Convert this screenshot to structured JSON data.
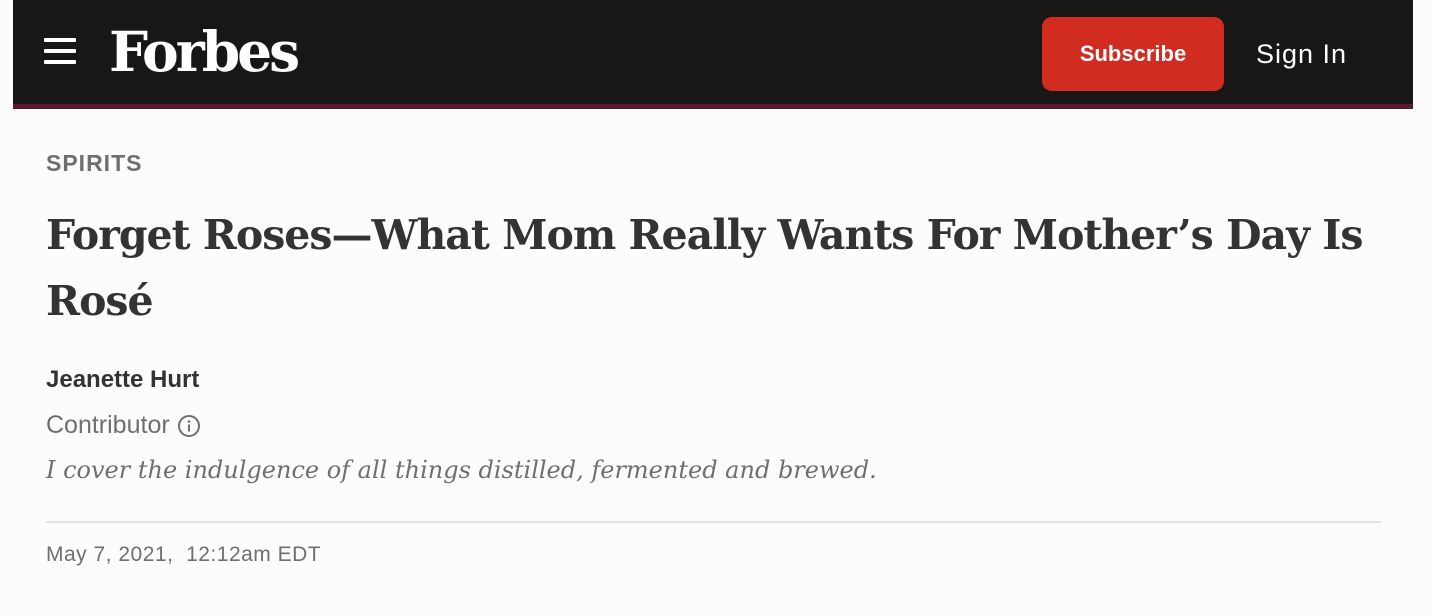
{
  "header": {
    "logo_text": "Forbes",
    "subscribe_label": "Subscribe",
    "sign_in_label": "Sign In",
    "menu_icon": "hamburger-menu-icon"
  },
  "article": {
    "section": "SPIRITS",
    "headline": "Forget Roses—What Mom Really Wants For Mother’s Day Is Rosé",
    "author": {
      "name": "Jeanette Hurt",
      "role": "Contributor",
      "role_icon": "info-icon",
      "bio": "I cover the indulgence of all things distilled, fermented and brewed."
    },
    "timestamp": "May 7, 2021,  12:12am EDT"
  },
  "colors": {
    "header_bg": "#181716",
    "header_border": "#5c1a2c",
    "subscribe_bg": "#d22b1f",
    "text_primary": "#333333",
    "text_secondary": "#6f6f6f"
  }
}
